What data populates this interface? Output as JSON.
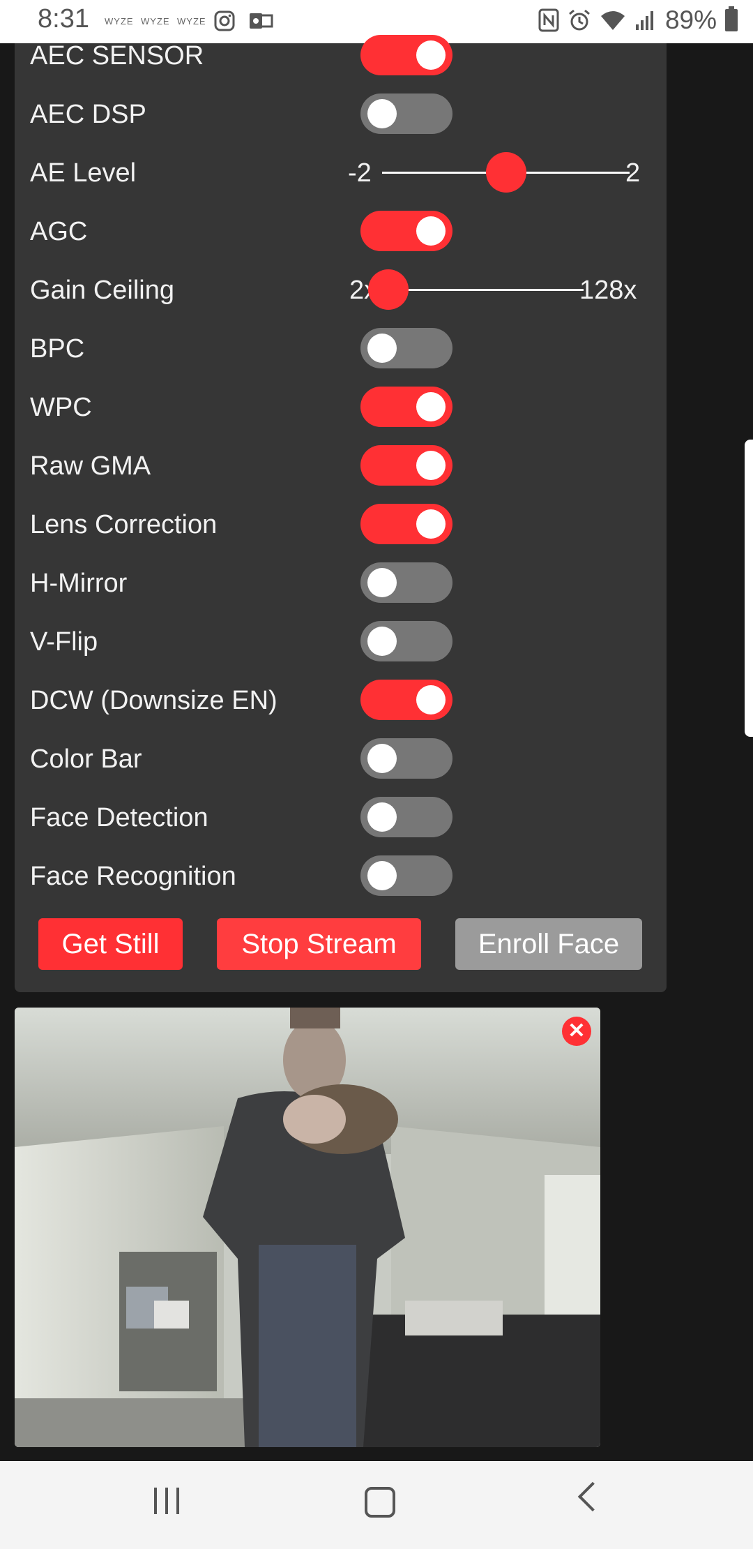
{
  "status_bar": {
    "time": "8:31",
    "notif_mini_1": "WYZE",
    "notif_mini_2": "WYZE",
    "notif_mini_3": "WYZE",
    "battery": "89%"
  },
  "settings": {
    "aec_sensor": {
      "label": "AEC SENSOR",
      "on": true
    },
    "aec_dsp": {
      "label": "AEC DSP",
      "on": false
    },
    "ae_level": {
      "label": "AE Level",
      "min": "-2",
      "max": "2",
      "value": 0,
      "range": [
        -2,
        2
      ]
    },
    "agc": {
      "label": "AGC",
      "on": true
    },
    "gain_ceiling": {
      "label": "Gain Ceiling",
      "min": "2x",
      "max": "128x",
      "value": 0,
      "range": [
        0,
        6
      ]
    },
    "bpc": {
      "label": "BPC",
      "on": false
    },
    "wpc": {
      "label": "WPC",
      "on": true
    },
    "raw_gma": {
      "label": "Raw GMA",
      "on": true
    },
    "lens_correction": {
      "label": "Lens Correction",
      "on": true
    },
    "h_mirror": {
      "label": "H-Mirror",
      "on": false
    },
    "v_flip": {
      "label": "V-Flip",
      "on": false
    },
    "dcw": {
      "label": "DCW (Downsize EN)",
      "on": true
    },
    "color_bar": {
      "label": "Color Bar",
      "on": false
    },
    "face_detection": {
      "label": "Face Detection",
      "on": false
    },
    "face_recognition": {
      "label": "Face Recognition",
      "on": false
    }
  },
  "buttons": {
    "get_still": "Get Still",
    "stop_stream": "Stop Stream",
    "enroll_face": "Enroll Face"
  },
  "colors": {
    "accent": "#ff3034",
    "panel": "#363636",
    "toggle_off": "#777777",
    "button_disabled": "#9b9b9b"
  },
  "video": {
    "close_icon": "close-icon"
  }
}
